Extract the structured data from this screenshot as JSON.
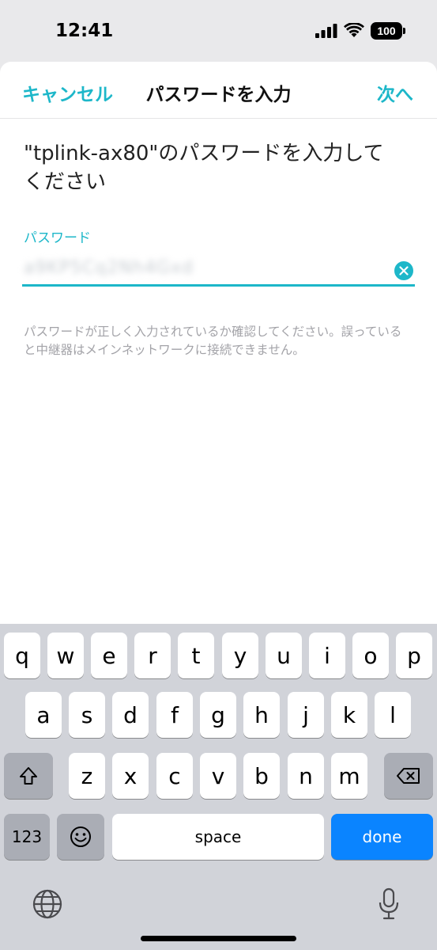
{
  "status_bar": {
    "time": "12:41",
    "battery": "100"
  },
  "nav": {
    "cancel": "キャンセル",
    "title": "パスワードを入力",
    "next": "次へ"
  },
  "prompt": {
    "line1": "\"tplink-ax80\"のパスワードを入力して",
    "line2": "ください"
  },
  "password": {
    "label": "パスワード",
    "value": "a9KP5Cq2Nh4Gxd"
  },
  "hint": "パスワードが正しく入力されているか確認してください。誤っていると中継器はメインネットワークに接続できません。",
  "keyboard": {
    "row1": [
      "q",
      "w",
      "e",
      "r",
      "t",
      "y",
      "u",
      "i",
      "o",
      "p"
    ],
    "row2": [
      "a",
      "s",
      "d",
      "f",
      "g",
      "h",
      "j",
      "k",
      "l"
    ],
    "row3": [
      "z",
      "x",
      "c",
      "v",
      "b",
      "n",
      "m"
    ],
    "numbers": "123",
    "space": "space",
    "done": "done"
  }
}
